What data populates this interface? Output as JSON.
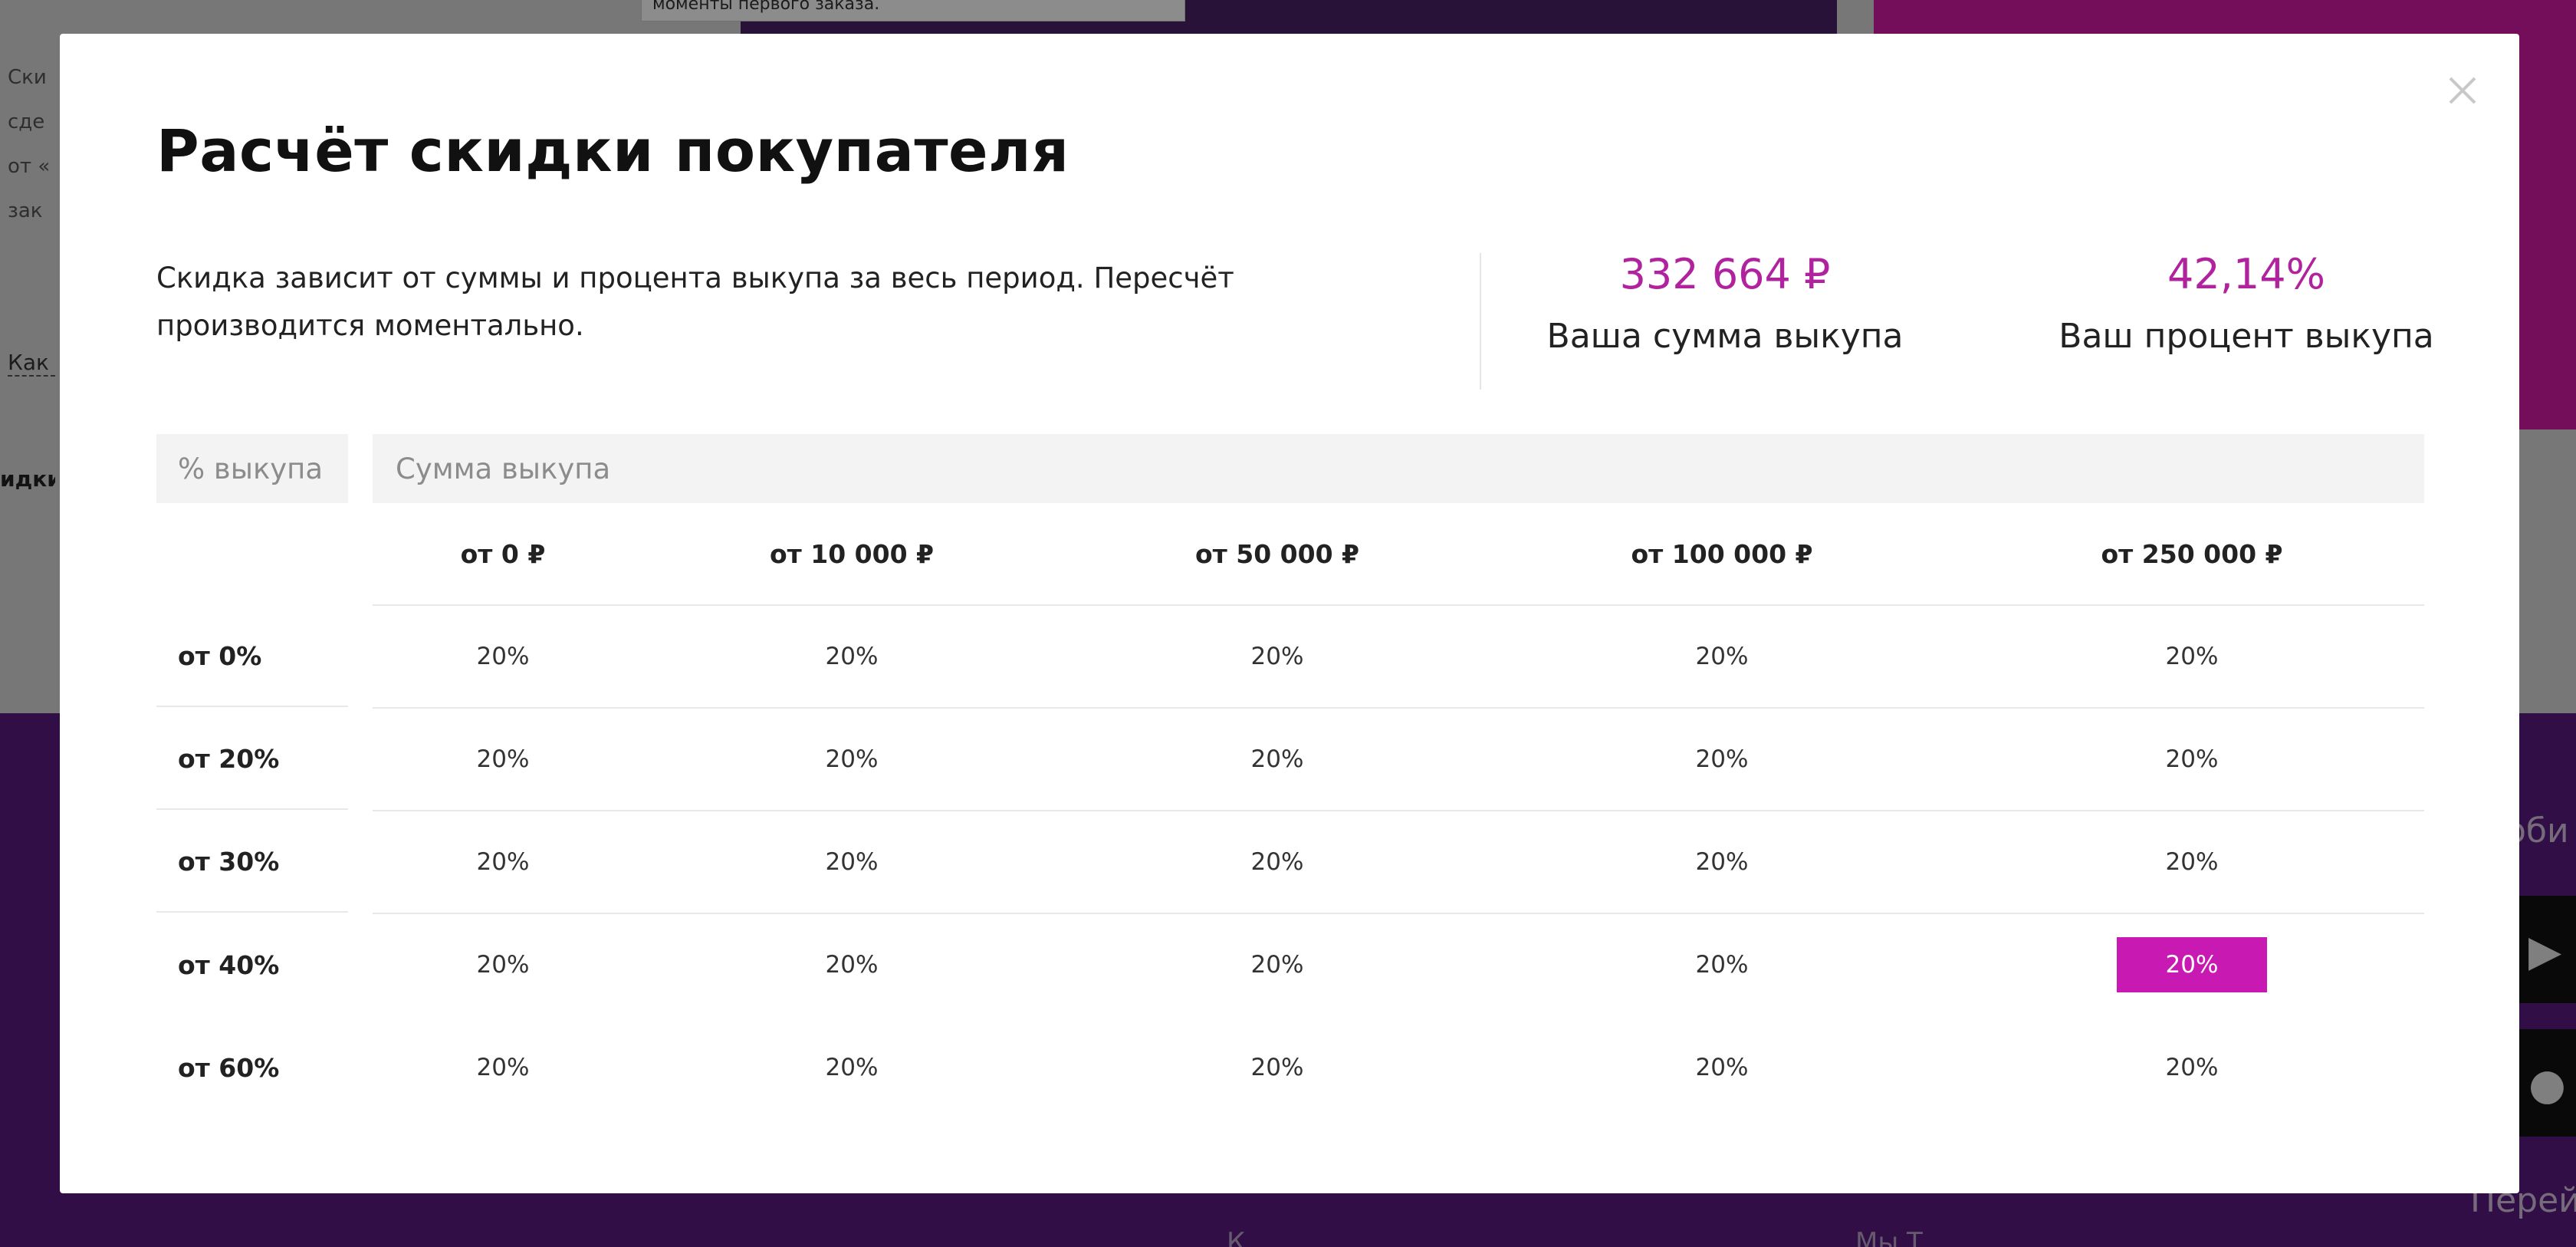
{
  "background": {
    "tooltip_text": "моменты первого заказа.",
    "left_text_lines": [
      "Ски",
      "сде",
      "от «",
      "зак"
    ],
    "left_link": "Как",
    "left_bold": "идки",
    "right_text": "оби",
    "right_bottom_text": "Перей",
    "bottom_snippets": [
      "К...",
      "Мы Т..."
    ]
  },
  "modal": {
    "title": "Расчёт скидки покупателя",
    "description": "Скидка зависит от суммы и процента выкупа за весь период. Пересчёт производится моментально.",
    "close_label": "×",
    "stats": {
      "sum_value": "332 664 ₽",
      "sum_label": "Ваша сумма выкупа",
      "pct_value": "42,14%",
      "pct_label": "Ваш процент выкупа"
    },
    "table": {
      "pct_header": "% выкупа",
      "sum_header": "Сумма выкупа",
      "sum_columns": [
        "от 0 ₽",
        "от 10 000 ₽",
        "от 50 000 ₽",
        "от 100 000 ₽",
        "от 250 000 ₽"
      ],
      "rows": [
        {
          "label": "от 0%",
          "cells": [
            "20%",
            "20%",
            "20%",
            "20%",
            "20%"
          ]
        },
        {
          "label": "от 20%",
          "cells": [
            "20%",
            "20%",
            "20%",
            "20%",
            "20%"
          ]
        },
        {
          "label": "от 30%",
          "cells": [
            "20%",
            "20%",
            "20%",
            "20%",
            "20%"
          ]
        },
        {
          "label": "от 40%",
          "cells": [
            "20%",
            "20%",
            "20%",
            "20%",
            "20%"
          ]
        },
        {
          "label": "от 60%",
          "cells": [
            "20%",
            "20%",
            "20%",
            "20%",
            "20%"
          ]
        }
      ],
      "active_cell": {
        "row": 3,
        "col": 4
      }
    },
    "accent_color": "#c81ab3"
  }
}
